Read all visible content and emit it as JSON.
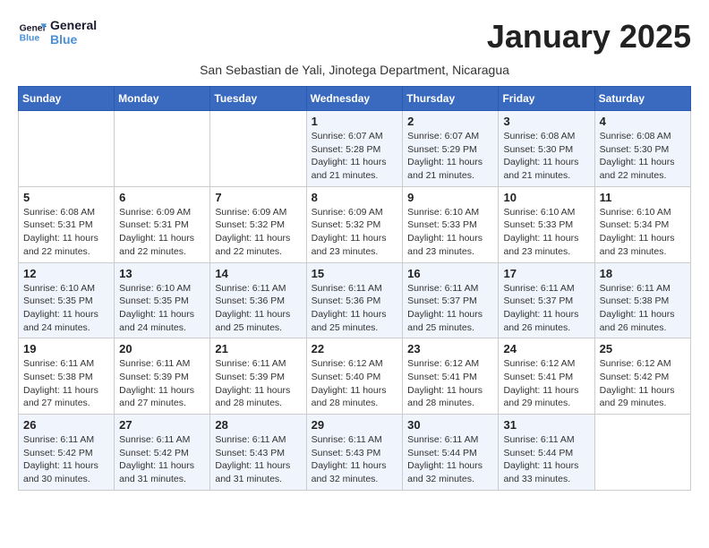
{
  "logo": {
    "line1": "General",
    "line2": "Blue"
  },
  "title": "January 2025",
  "subtitle": "San Sebastian de Yali, Jinotega Department, Nicaragua",
  "weekdays": [
    "Sunday",
    "Monday",
    "Tuesday",
    "Wednesday",
    "Thursday",
    "Friday",
    "Saturday"
  ],
  "weeks": [
    [
      {
        "day": "",
        "info": ""
      },
      {
        "day": "",
        "info": ""
      },
      {
        "day": "",
        "info": ""
      },
      {
        "day": "1",
        "info": "Sunrise: 6:07 AM\nSunset: 5:28 PM\nDaylight: 11 hours\nand 21 minutes."
      },
      {
        "day": "2",
        "info": "Sunrise: 6:07 AM\nSunset: 5:29 PM\nDaylight: 11 hours\nand 21 minutes."
      },
      {
        "day": "3",
        "info": "Sunrise: 6:08 AM\nSunset: 5:30 PM\nDaylight: 11 hours\nand 21 minutes."
      },
      {
        "day": "4",
        "info": "Sunrise: 6:08 AM\nSunset: 5:30 PM\nDaylight: 11 hours\nand 22 minutes."
      }
    ],
    [
      {
        "day": "5",
        "info": "Sunrise: 6:08 AM\nSunset: 5:31 PM\nDaylight: 11 hours\nand 22 minutes."
      },
      {
        "day": "6",
        "info": "Sunrise: 6:09 AM\nSunset: 5:31 PM\nDaylight: 11 hours\nand 22 minutes."
      },
      {
        "day": "7",
        "info": "Sunrise: 6:09 AM\nSunset: 5:32 PM\nDaylight: 11 hours\nand 22 minutes."
      },
      {
        "day": "8",
        "info": "Sunrise: 6:09 AM\nSunset: 5:32 PM\nDaylight: 11 hours\nand 23 minutes."
      },
      {
        "day": "9",
        "info": "Sunrise: 6:10 AM\nSunset: 5:33 PM\nDaylight: 11 hours\nand 23 minutes."
      },
      {
        "day": "10",
        "info": "Sunrise: 6:10 AM\nSunset: 5:33 PM\nDaylight: 11 hours\nand 23 minutes."
      },
      {
        "day": "11",
        "info": "Sunrise: 6:10 AM\nSunset: 5:34 PM\nDaylight: 11 hours\nand 23 minutes."
      }
    ],
    [
      {
        "day": "12",
        "info": "Sunrise: 6:10 AM\nSunset: 5:35 PM\nDaylight: 11 hours\nand 24 minutes."
      },
      {
        "day": "13",
        "info": "Sunrise: 6:10 AM\nSunset: 5:35 PM\nDaylight: 11 hours\nand 24 minutes."
      },
      {
        "day": "14",
        "info": "Sunrise: 6:11 AM\nSunset: 5:36 PM\nDaylight: 11 hours\nand 25 minutes."
      },
      {
        "day": "15",
        "info": "Sunrise: 6:11 AM\nSunset: 5:36 PM\nDaylight: 11 hours\nand 25 minutes."
      },
      {
        "day": "16",
        "info": "Sunrise: 6:11 AM\nSunset: 5:37 PM\nDaylight: 11 hours\nand 25 minutes."
      },
      {
        "day": "17",
        "info": "Sunrise: 6:11 AM\nSunset: 5:37 PM\nDaylight: 11 hours\nand 26 minutes."
      },
      {
        "day": "18",
        "info": "Sunrise: 6:11 AM\nSunset: 5:38 PM\nDaylight: 11 hours\nand 26 minutes."
      }
    ],
    [
      {
        "day": "19",
        "info": "Sunrise: 6:11 AM\nSunset: 5:38 PM\nDaylight: 11 hours\nand 27 minutes."
      },
      {
        "day": "20",
        "info": "Sunrise: 6:11 AM\nSunset: 5:39 PM\nDaylight: 11 hours\nand 27 minutes."
      },
      {
        "day": "21",
        "info": "Sunrise: 6:11 AM\nSunset: 5:39 PM\nDaylight: 11 hours\nand 28 minutes."
      },
      {
        "day": "22",
        "info": "Sunrise: 6:12 AM\nSunset: 5:40 PM\nDaylight: 11 hours\nand 28 minutes."
      },
      {
        "day": "23",
        "info": "Sunrise: 6:12 AM\nSunset: 5:41 PM\nDaylight: 11 hours\nand 28 minutes."
      },
      {
        "day": "24",
        "info": "Sunrise: 6:12 AM\nSunset: 5:41 PM\nDaylight: 11 hours\nand 29 minutes."
      },
      {
        "day": "25",
        "info": "Sunrise: 6:12 AM\nSunset: 5:42 PM\nDaylight: 11 hours\nand 29 minutes."
      }
    ],
    [
      {
        "day": "26",
        "info": "Sunrise: 6:11 AM\nSunset: 5:42 PM\nDaylight: 11 hours\nand 30 minutes."
      },
      {
        "day": "27",
        "info": "Sunrise: 6:11 AM\nSunset: 5:42 PM\nDaylight: 11 hours\nand 31 minutes."
      },
      {
        "day": "28",
        "info": "Sunrise: 6:11 AM\nSunset: 5:43 PM\nDaylight: 11 hours\nand 31 minutes."
      },
      {
        "day": "29",
        "info": "Sunrise: 6:11 AM\nSunset: 5:43 PM\nDaylight: 11 hours\nand 32 minutes."
      },
      {
        "day": "30",
        "info": "Sunrise: 6:11 AM\nSunset: 5:44 PM\nDaylight: 11 hours\nand 32 minutes."
      },
      {
        "day": "31",
        "info": "Sunrise: 6:11 AM\nSunset: 5:44 PM\nDaylight: 11 hours\nand 33 minutes."
      },
      {
        "day": "",
        "info": ""
      }
    ]
  ]
}
